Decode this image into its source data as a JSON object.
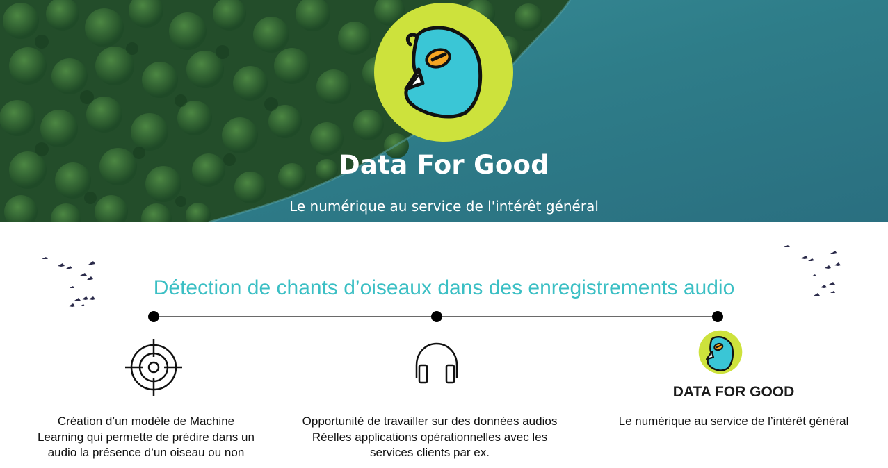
{
  "hero": {
    "title": "Data For Good",
    "subtitle": "Le numérique au service de l'intérêt général"
  },
  "section": {
    "title": "Détection de chants d’oiseaux dans des enregistrements audio"
  },
  "columns": [
    {
      "icon": "target-icon",
      "lines": [
        "Création d’un modèle de Machine",
        "Learning qui permette de prédire dans un",
        "audio la présence d’un oiseau ou non"
      ]
    },
    {
      "icon": "headphones-icon",
      "lines": [
        "Opportunité de travailler  sur des données audios",
        "Réelles applications opérationnelles avec les",
        "services clients par ex."
      ]
    },
    {
      "icon": "bird-logo-icon",
      "brand": "DATA FOR GOOD",
      "lines": [
        "Le numérique au service de l’intérêt général"
      ]
    }
  ],
  "colors": {
    "accent": "#3bbfc4",
    "logo_circle": "#cde23c",
    "bird_body": "#3ac6d6",
    "bird_eye": "#f5a623",
    "water": "#2f7f8c",
    "forest": "#2a5a30"
  }
}
